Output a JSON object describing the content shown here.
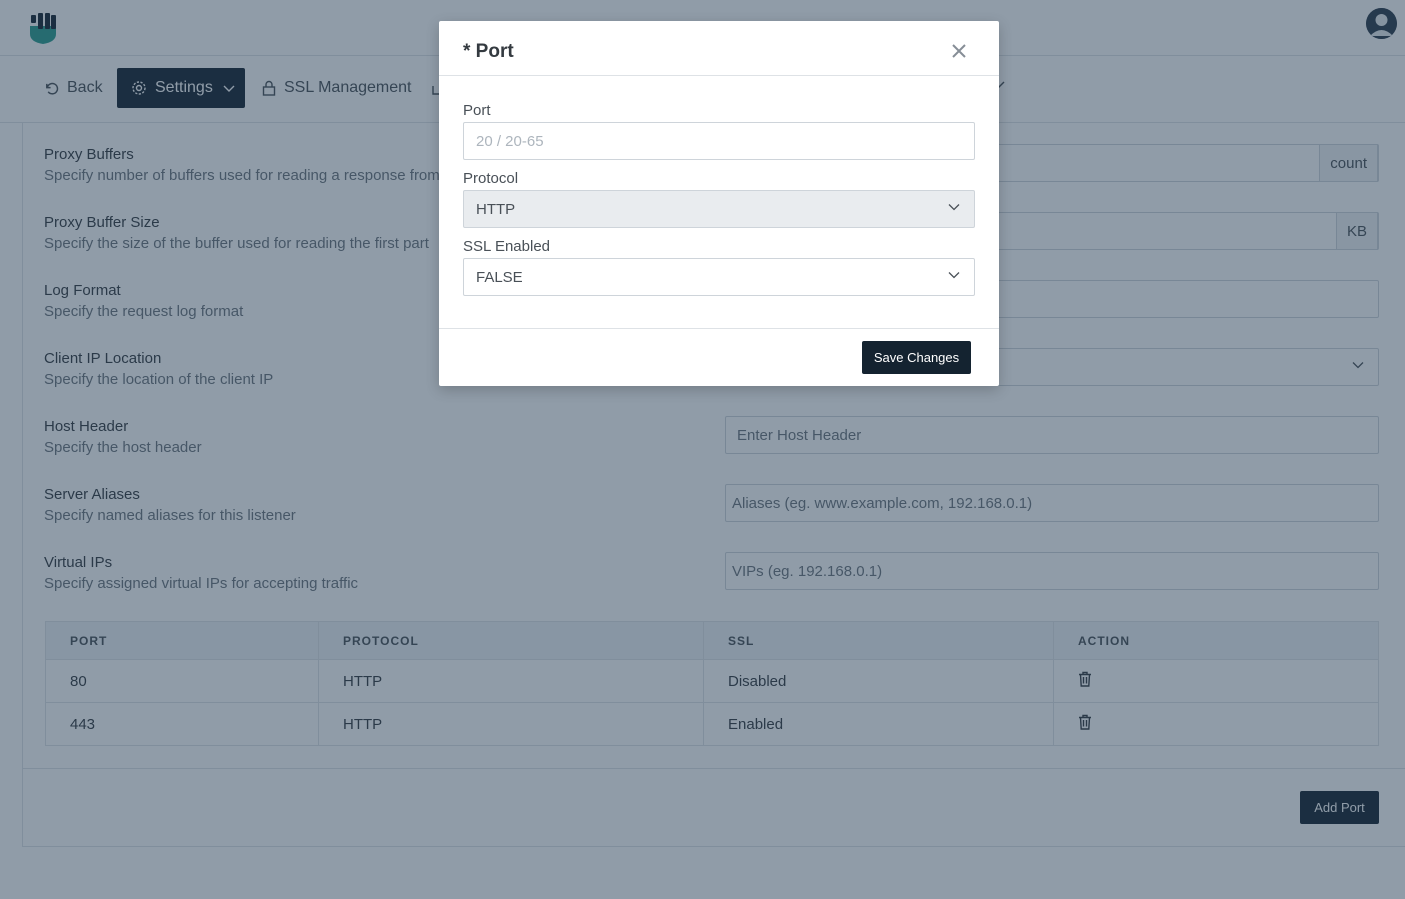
{
  "nav": {
    "back_label": "Back",
    "settings_label": "Settings",
    "ssl_label": "SSL Management"
  },
  "settings": [
    {
      "label": "Proxy Buffers",
      "desc": "Specify number of buffers used for reading a response from",
      "addon": "count"
    },
    {
      "label": "Proxy Buffer Size",
      "desc": "Specify the size of the buffer used for reading the first part",
      "addon": "KB"
    },
    {
      "label": "Log Format",
      "desc": "Specify the request log format"
    },
    {
      "label": "Client IP Location",
      "desc": "Specify the location of the client IP"
    },
    {
      "label": "Host Header",
      "desc": "Specify the host header",
      "placeholder": "Enter Host Header"
    },
    {
      "label": "Server Aliases",
      "desc": "Specify named aliases for this listener",
      "placeholder": "Aliases (eg. www.example.com, 192.168.0.1)"
    },
    {
      "label": "Virtual IPs",
      "desc": "Specify assigned virtual IPs for accepting traffic",
      "placeholder": "VIPs (eg. 192.168.0.1)"
    }
  ],
  "table": {
    "headers": [
      "PORT",
      "PROTOCOL",
      "SSL",
      "ACTION"
    ],
    "rows": [
      {
        "port": "80",
        "protocol": "HTTP",
        "ssl": "Disabled"
      },
      {
        "port": "443",
        "protocol": "HTTP",
        "ssl": "Enabled"
      }
    ]
  },
  "add_port_label": "Add Port",
  "modal": {
    "title": "* Port",
    "port_label": "Port",
    "port_placeholder": "20 / 20-65",
    "protocol_label": "Protocol",
    "protocol_value": "HTTP",
    "ssl_label": "SSL Enabled",
    "ssl_value": "FALSE",
    "save_label": "Save Changes"
  },
  "colors": {
    "primary": "#142330",
    "brand_teal": "#2a9d8f",
    "overlay": "rgba(33, 58, 82, 0.5)"
  }
}
